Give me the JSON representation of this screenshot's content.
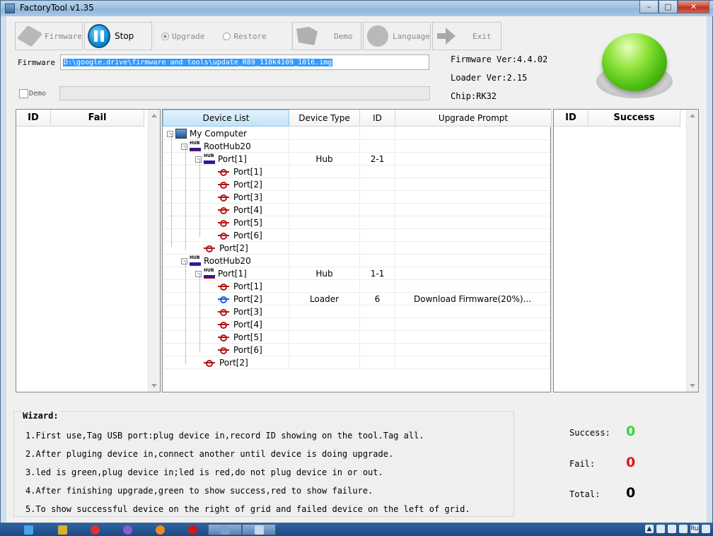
{
  "window": {
    "title": "FactoryTool v1.35"
  },
  "toolbar": {
    "firmware": "Firmware",
    "stop": "Stop",
    "upgrade": "Upgrade",
    "restore": "Restore",
    "demo": "Demo",
    "language": "Language",
    "exit": "Exit",
    "upgrade_selected": true
  },
  "firmware": {
    "label": "Firmware",
    "path": "D:\\google.drive\\firmware and tools\\update_R89_110k4109_1016.img"
  },
  "demo": {
    "label": "Demo",
    "checked": false
  },
  "info": {
    "firmware_ver": "Firmware Ver:4.4.02",
    "loader_ver": "Loader Ver:2.15",
    "chip": "Chip:RK32"
  },
  "fail_grid": {
    "col_id": "ID",
    "col_fail": "Fail"
  },
  "success_grid": {
    "col_id": "ID",
    "col_success": "Success"
  },
  "device_list": {
    "headers": [
      "Device List",
      "Device Type",
      "ID",
      "Upgrade Prompt"
    ],
    "rows": [
      {
        "label": "My Computer",
        "icon": "computer-icon",
        "level": 0,
        "expander": "-",
        "type": "",
        "id": "",
        "prompt": ""
      },
      {
        "label": "RootHub20",
        "icon": "hub-icon",
        "level": 1,
        "expander": "-",
        "type": "",
        "id": "",
        "prompt": ""
      },
      {
        "label": "Port[1]",
        "icon": "hub-icon",
        "level": 2,
        "expander": "-",
        "type": "Hub",
        "id": "2-1",
        "prompt": ""
      },
      {
        "label": "Port[1]",
        "icon": "usb-icon",
        "level": 3,
        "expander": "",
        "type": "",
        "id": "",
        "prompt": ""
      },
      {
        "label": "Port[2]",
        "icon": "usb-icon",
        "level": 3,
        "expander": "",
        "type": "",
        "id": "",
        "prompt": ""
      },
      {
        "label": "Port[3]",
        "icon": "usb-icon",
        "level": 3,
        "expander": "",
        "type": "",
        "id": "",
        "prompt": ""
      },
      {
        "label": "Port[4]",
        "icon": "usb-icon",
        "level": 3,
        "expander": "",
        "type": "",
        "id": "",
        "prompt": ""
      },
      {
        "label": "Port[5]",
        "icon": "usb-icon",
        "level": 3,
        "expander": "",
        "type": "",
        "id": "",
        "prompt": ""
      },
      {
        "label": "Port[6]",
        "icon": "usb-icon",
        "level": 3,
        "expander": "",
        "type": "",
        "id": "",
        "prompt": ""
      },
      {
        "label": "Port[2]",
        "icon": "usb-icon",
        "level": 2,
        "expander": "",
        "type": "",
        "id": "",
        "prompt": ""
      },
      {
        "label": "RootHub20",
        "icon": "hub-icon",
        "level": 1,
        "expander": "-",
        "type": "",
        "id": "",
        "prompt": ""
      },
      {
        "label": "Port[1]",
        "icon": "hub-icon",
        "level": 2,
        "expander": "-",
        "type": "Hub",
        "id": "1-1",
        "prompt": ""
      },
      {
        "label": "Port[1]",
        "icon": "usb-icon",
        "level": 3,
        "expander": "",
        "type": "",
        "id": "",
        "prompt": ""
      },
      {
        "label": "Port[2]",
        "icon": "usb-icon-active",
        "level": 3,
        "expander": "",
        "type": "Loader",
        "id": "6",
        "prompt": "Download Firmware(20%)..."
      },
      {
        "label": "Port[3]",
        "icon": "usb-icon",
        "level": 3,
        "expander": "",
        "type": "",
        "id": "",
        "prompt": ""
      },
      {
        "label": "Port[4]",
        "icon": "usb-icon",
        "level": 3,
        "expander": "",
        "type": "",
        "id": "",
        "prompt": ""
      },
      {
        "label": "Port[5]",
        "icon": "usb-icon",
        "level": 3,
        "expander": "",
        "type": "",
        "id": "",
        "prompt": ""
      },
      {
        "label": "Port[6]",
        "icon": "usb-icon",
        "level": 3,
        "expander": "",
        "type": "",
        "id": "",
        "prompt": ""
      },
      {
        "label": "Port[2]",
        "icon": "usb-icon",
        "level": 2,
        "expander": "",
        "type": "",
        "id": "",
        "prompt": ""
      }
    ]
  },
  "wizard": {
    "title": "Wizard:",
    "steps": [
      "1.First use,Tag USB port:plug device in,record ID showing on the tool.Tag all.",
      "2.After pluging device in,connect another until device is doing upgrade.",
      "3.led is green,plug device in;led is red,do not plug device in or out.",
      "4.After finishing upgrade,green to show success,red to show failure.",
      "5.To show successful device on the right of grid and failed device on the left of grid."
    ]
  },
  "stats": {
    "success_label": "Success:",
    "success_value": "0",
    "fail_label": "Fail:",
    "fail_value": "0",
    "total_label": "Total:",
    "total_value": "0"
  },
  "colors": {
    "success": "#3ad33a",
    "fail": "#e01818",
    "selection": "#3399ff",
    "status_led": "#56c41b"
  },
  "taskbar": {
    "tray_lang": "Ru"
  }
}
